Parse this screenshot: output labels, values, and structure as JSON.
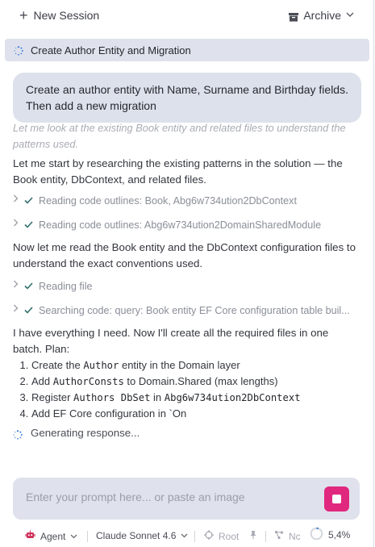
{
  "header": {
    "new_session_label": "New Session",
    "archive_label": "Archive"
  },
  "session": {
    "title": "Create Author Entity and Migration"
  },
  "user_message": "Create an author entity with Name, Surname and Birthday fields. Then add a new migration",
  "assistant": {
    "thinking_faded": "Let me look at the existing Book entity and related files to understand the patterns used.",
    "para1": "Let me start by researching the existing patterns in the solution — the Book entity, DbContext, and related files.",
    "tool1": "Reading code outlines: Book, Abg6w734ution2DbContext",
    "tool2": "Reading code outlines: Abg6w734ution2DomainSharedModule",
    "para2": "Now let me read the Book entity and the DbContext configuration files to understand the exact conventions used.",
    "tool3": "Reading file",
    "tool4": "Searching code: query: Book entity EF Core configuration table buil...",
    "plan_intro": "I have everything I need. Now I'll create all the required files in one batch. Plan:",
    "plan": [
      {
        "pre": "Create the ",
        "code": "Author",
        "post": " entity in the Domain layer"
      },
      {
        "pre": "Add ",
        "code": "AuthorConsts",
        "post": " to Domain.Shared (max lengths)"
      },
      {
        "pre": "Register ",
        "code": "Authors DbSet",
        "mid": " in ",
        "code2": "Abg6w734ution2DbContext"
      },
      {
        "pre": "Add EF Core configuration in `On"
      }
    ],
    "generating": "Generating response..."
  },
  "prompt": {
    "placeholder": "Enter your prompt here... or paste an image"
  },
  "footer": {
    "agent_label": "Agent",
    "model_label": "Claude Sonnet 4.6",
    "root_label": "Root",
    "nc_label": "Nc",
    "percent": "5,4%",
    "context_usage_fraction": 0.054
  },
  "colors": {
    "accent": "#e0287f",
    "check": "#2f6f6a",
    "spinner": "#3d7ddb",
    "bubble": "#dde1ec"
  }
}
